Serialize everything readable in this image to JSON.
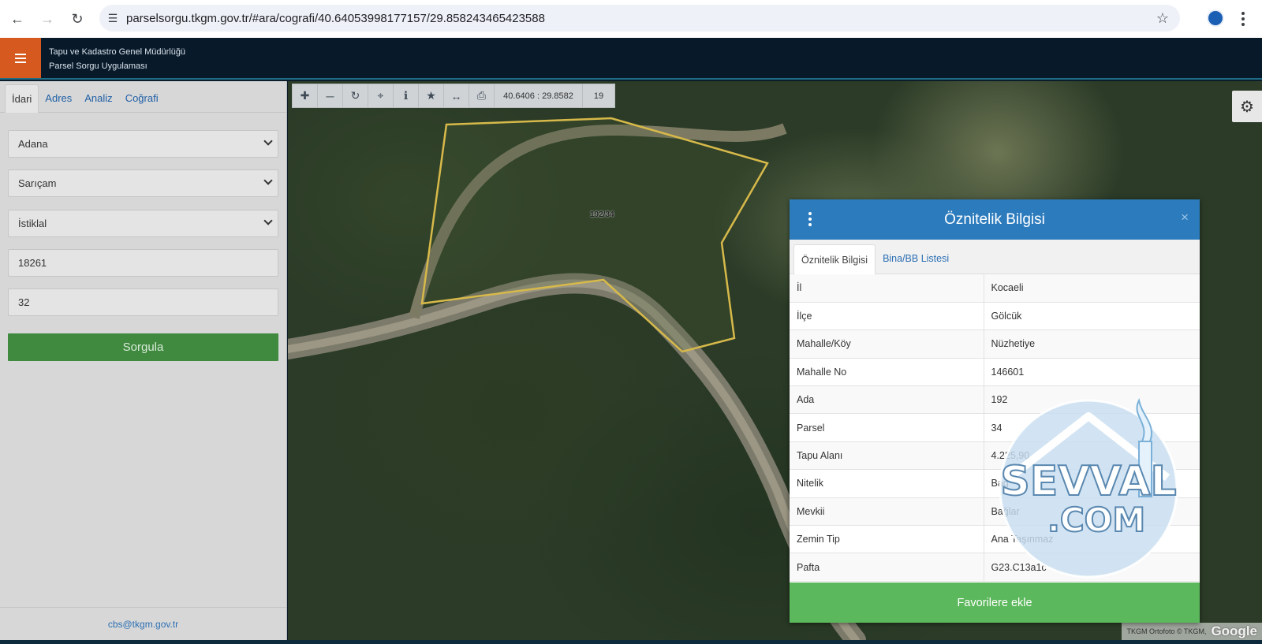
{
  "browser": {
    "url": "parselsorgu.tkgm.gov.tr/#ara/cografi/40.64053998177157/29.858243465423588"
  },
  "header": {
    "line1": "Tapu ve Kadastro Genel Müdürlüğü",
    "line2": "Parsel Sorgu Uygulaması"
  },
  "sidebar": {
    "tabs": [
      {
        "label": "İdari",
        "active": true
      },
      {
        "label": "Adres",
        "active": false
      },
      {
        "label": "Analiz",
        "active": false
      },
      {
        "label": "Coğrafi",
        "active": false
      }
    ],
    "province": "Adana",
    "district": "Sarıçam",
    "neighborhood": "İstiklal",
    "block_no": "18261",
    "parcel_no": "32",
    "submit_label": "Sorgula",
    "footer_email": "cbs@tkgm.gov.tr"
  },
  "map": {
    "coordinates": "40.6406 : 29.8582",
    "zoom": "19",
    "parcel_label": "192/34",
    "attribution": "TKGM Ortofoto © TKGM,",
    "google": "Google",
    "parcel_color": "#d7b94a"
  },
  "panel": {
    "title": "Öznitelik Bilgisi",
    "close": "×",
    "tabs": [
      {
        "label": "Öznitelik Bilgisi",
        "active": true
      },
      {
        "label": "Bina/BB Listesi",
        "active": false
      }
    ],
    "rows": [
      {
        "key": "İl",
        "value": "Kocaeli"
      },
      {
        "key": "İlçe",
        "value": "Gölcük"
      },
      {
        "key": "Mahalle/Köy",
        "value": "Nüzhetiye"
      },
      {
        "key": "Mahalle No",
        "value": "146601"
      },
      {
        "key": "Ada",
        "value": "192"
      },
      {
        "key": "Parsel",
        "value": "34"
      },
      {
        "key": "Tapu Alanı",
        "value": "4.225,90"
      },
      {
        "key": "Nitelik",
        "value": "Bağ"
      },
      {
        "key": "Mevkii",
        "value": "Bağlar"
      },
      {
        "key": "Zemin Tip",
        "value": "Ana Taşınmaz"
      },
      {
        "key": "Pafta",
        "value": "G23.C13a1c"
      }
    ],
    "favorite_label": "Favorilere ekle",
    "header_color": "#2c7bbd",
    "favorite_color": "#5cb85c"
  },
  "watermark": {
    "line1": "SEVVAL",
    "line2": ".COM"
  }
}
